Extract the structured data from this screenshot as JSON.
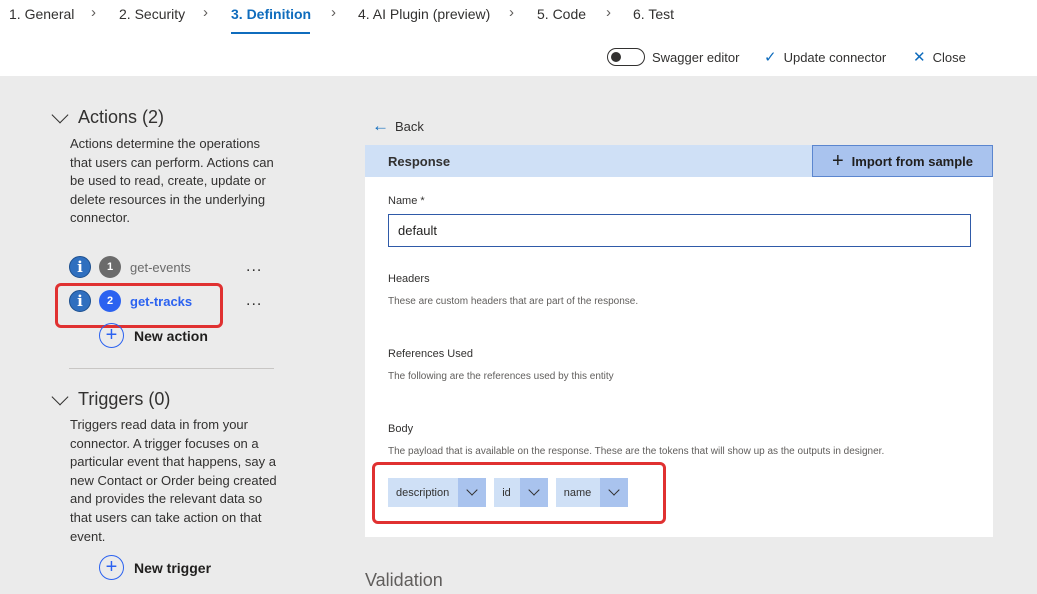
{
  "steps": [
    {
      "label": "1. General"
    },
    {
      "label": "2. Security"
    },
    {
      "label": "3. Definition",
      "active": true
    },
    {
      "label": "4. AI Plugin (preview)"
    },
    {
      "label": "5. Code"
    },
    {
      "label": "6. Test"
    }
  ],
  "commands": {
    "swagger_editor": "Swagger editor",
    "update_connector": "Update connector",
    "close": "Close"
  },
  "actions": {
    "title": "Actions (2)",
    "description": "Actions determine the operations that users can perform. Actions can be used to read, create, update or delete resources in the underlying connector.",
    "items": [
      {
        "number": "1",
        "label": "get-events",
        "selected": false
      },
      {
        "number": "2",
        "label": "get-tracks",
        "selected": true
      }
    ],
    "new_label": "New action",
    "more_label": "..."
  },
  "triggers": {
    "title": "Triggers (0)",
    "description": "Triggers read data in from your connector. A trigger focuses on a particular event that happens, say a new Contact or Order being created and provides the relevant data so that users can take action on that event.",
    "new_label": "New trigger"
  },
  "editor": {
    "back_label": "Back",
    "response_title": "Response",
    "import_label": "Import from sample",
    "name_label": "Name *",
    "name_value": "default",
    "headers_label": "Headers",
    "headers_desc": "These are custom headers that are part of the response.",
    "refs_label": "References Used",
    "refs_desc": "The following are the references used by this entity",
    "body_label": "Body",
    "body_desc": "The payload that is available on the response. These are the tokens that will show up as the outputs in designer.",
    "tokens": [
      "description",
      "id",
      "name"
    ],
    "validation_label": "Validation"
  },
  "colors": {
    "accent": "#0f6cbd",
    "selected_number": "#2b62f0",
    "highlight_box": "#e03131",
    "response_header": "#cfe0f6"
  },
  "icons": {
    "info": "info-icon",
    "back": "arrow-left-icon",
    "import": "plus-icon",
    "check": "checkmark-icon",
    "close": "close-icon",
    "chevron": "chevron-down-icon"
  }
}
